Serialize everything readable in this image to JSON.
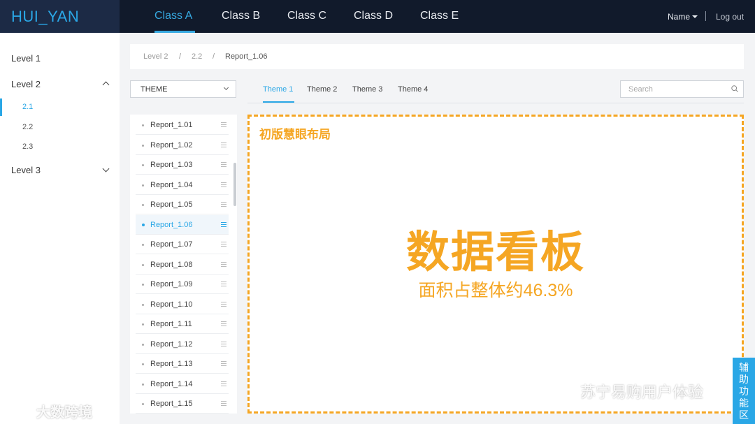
{
  "app": {
    "logo": "HUI_YAN"
  },
  "nav": {
    "tabs": [
      "Class A",
      "Class B",
      "Class C",
      "Class D",
      "Class E"
    ],
    "active_index": 0
  },
  "user": {
    "name": "Name",
    "logout": "Log out"
  },
  "sidebar": {
    "level1": "Level 1",
    "level2": "Level 2",
    "level2_children": [
      "2.1",
      "2.2",
      "2.3"
    ],
    "active_child": "2.1",
    "level3": "Level 3"
  },
  "breadcrumb": {
    "items": [
      "Level 2",
      "2.2",
      "Report_1.06"
    ],
    "separator": "/"
  },
  "toolbar": {
    "theme_select": "THEME",
    "theme_tabs": [
      "Theme 1",
      "Theme 2",
      "Theme 3",
      "Theme 4"
    ],
    "active_theme": "Theme 1",
    "search_placeholder": "Search"
  },
  "reports": {
    "items": [
      "Report_1.01",
      "Report_1.02",
      "Report_1.03",
      "Report_1.04",
      "Report_1.05",
      "Report_1.06",
      "Report_1.07",
      "Report_1.08",
      "Report_1.09",
      "Report_1.10",
      "Report_1.11",
      "Report_1.12",
      "Report_1.13",
      "Report_1.14",
      "Report_1.15"
    ],
    "active_index": 5
  },
  "dashboard": {
    "label": "初版慧眼布局",
    "title": "数据看板",
    "subtitle": "面积占整体约46.3%"
  },
  "assist": {
    "label": "辅助功能区"
  },
  "watermarks": {
    "left": "大数跨境",
    "right": "苏宁易购用户体验"
  },
  "colors": {
    "accent": "#2aa7e6",
    "highlight": "#f5a623",
    "topbar": "#111a2b"
  }
}
